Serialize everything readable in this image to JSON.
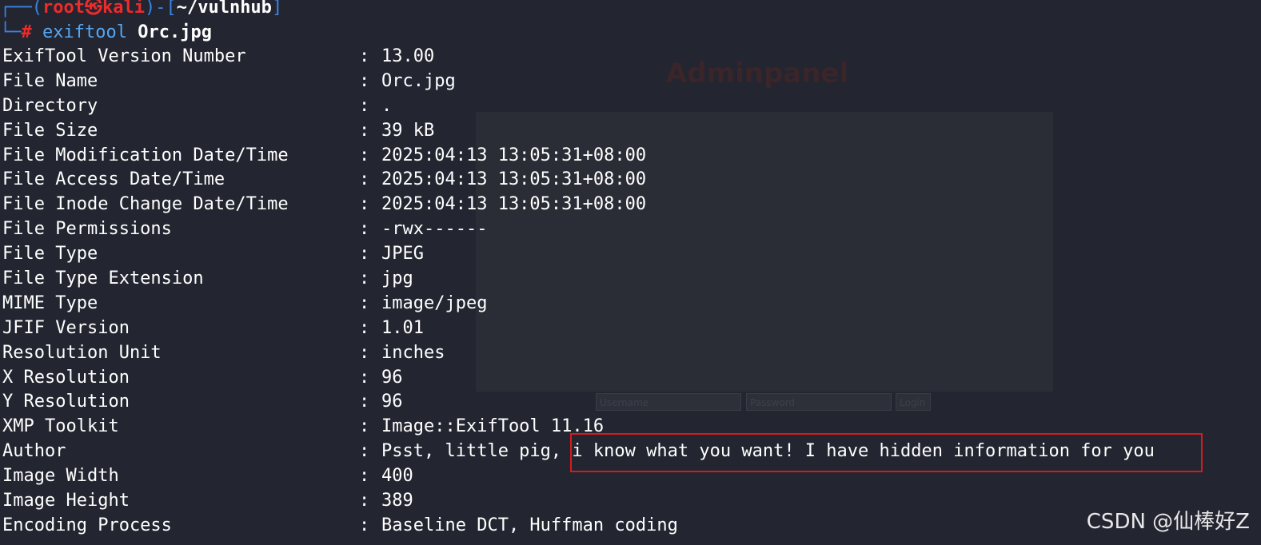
{
  "wallpaper": {
    "title": "Adminpanel",
    "username_placeholder": "Username",
    "password_placeholder": "Password",
    "login_label": "Login"
  },
  "prompt": {
    "open_bracket": "┌──(",
    "user": "root",
    "skull": "㉿",
    "host": "kali",
    "mid": ")-[",
    "cwd": "~/vulnhub",
    "close": "]",
    "line2_prefix": "└─",
    "hash": "# ",
    "command": "exiftool ",
    "argument": "Orc.jpg"
  },
  "rows": [
    {
      "key": "ExifTool Version Number",
      "value": "13.00"
    },
    {
      "key": "File Name",
      "value": "Orc.jpg"
    },
    {
      "key": "Directory",
      "value": "."
    },
    {
      "key": "File Size",
      "value": "39 kB"
    },
    {
      "key": "File Modification Date/Time",
      "value": "2025:04:13 13:05:31+08:00"
    },
    {
      "key": "File Access Date/Time",
      "value": "2025:04:13 13:05:31+08:00"
    },
    {
      "key": "File Inode Change Date/Time",
      "value": "2025:04:13 13:05:31+08:00"
    },
    {
      "key": "File Permissions",
      "value": "-rwx------"
    },
    {
      "key": "File Type",
      "value": "JPEG"
    },
    {
      "key": "File Type Extension",
      "value": "jpg"
    },
    {
      "key": "MIME Type",
      "value": "image/jpeg"
    },
    {
      "key": "JFIF Version",
      "value": "1.01"
    },
    {
      "key": "Resolution Unit",
      "value": "inches"
    },
    {
      "key": "X Resolution",
      "value": "96"
    },
    {
      "key": "Y Resolution",
      "value": "96"
    },
    {
      "key": "XMP Toolkit",
      "value": "Image::ExifTool 11.16"
    },
    {
      "key": "Author",
      "value": "Psst, little pig, i know what you want! I have hidden information for you"
    },
    {
      "key": "Image Width",
      "value": "400"
    },
    {
      "key": "Image Height",
      "value": "389"
    },
    {
      "key": "Encoding Process",
      "value": "Baseline DCT, Huffman coding"
    }
  ],
  "separator": ": ",
  "watermark": "CSDN @仙棒好Z",
  "colors": {
    "background": "#232530",
    "prompt_blue": "#3b84e3",
    "prompt_red": "#ed2b2b",
    "highlight_border": "#d01e1e"
  }
}
